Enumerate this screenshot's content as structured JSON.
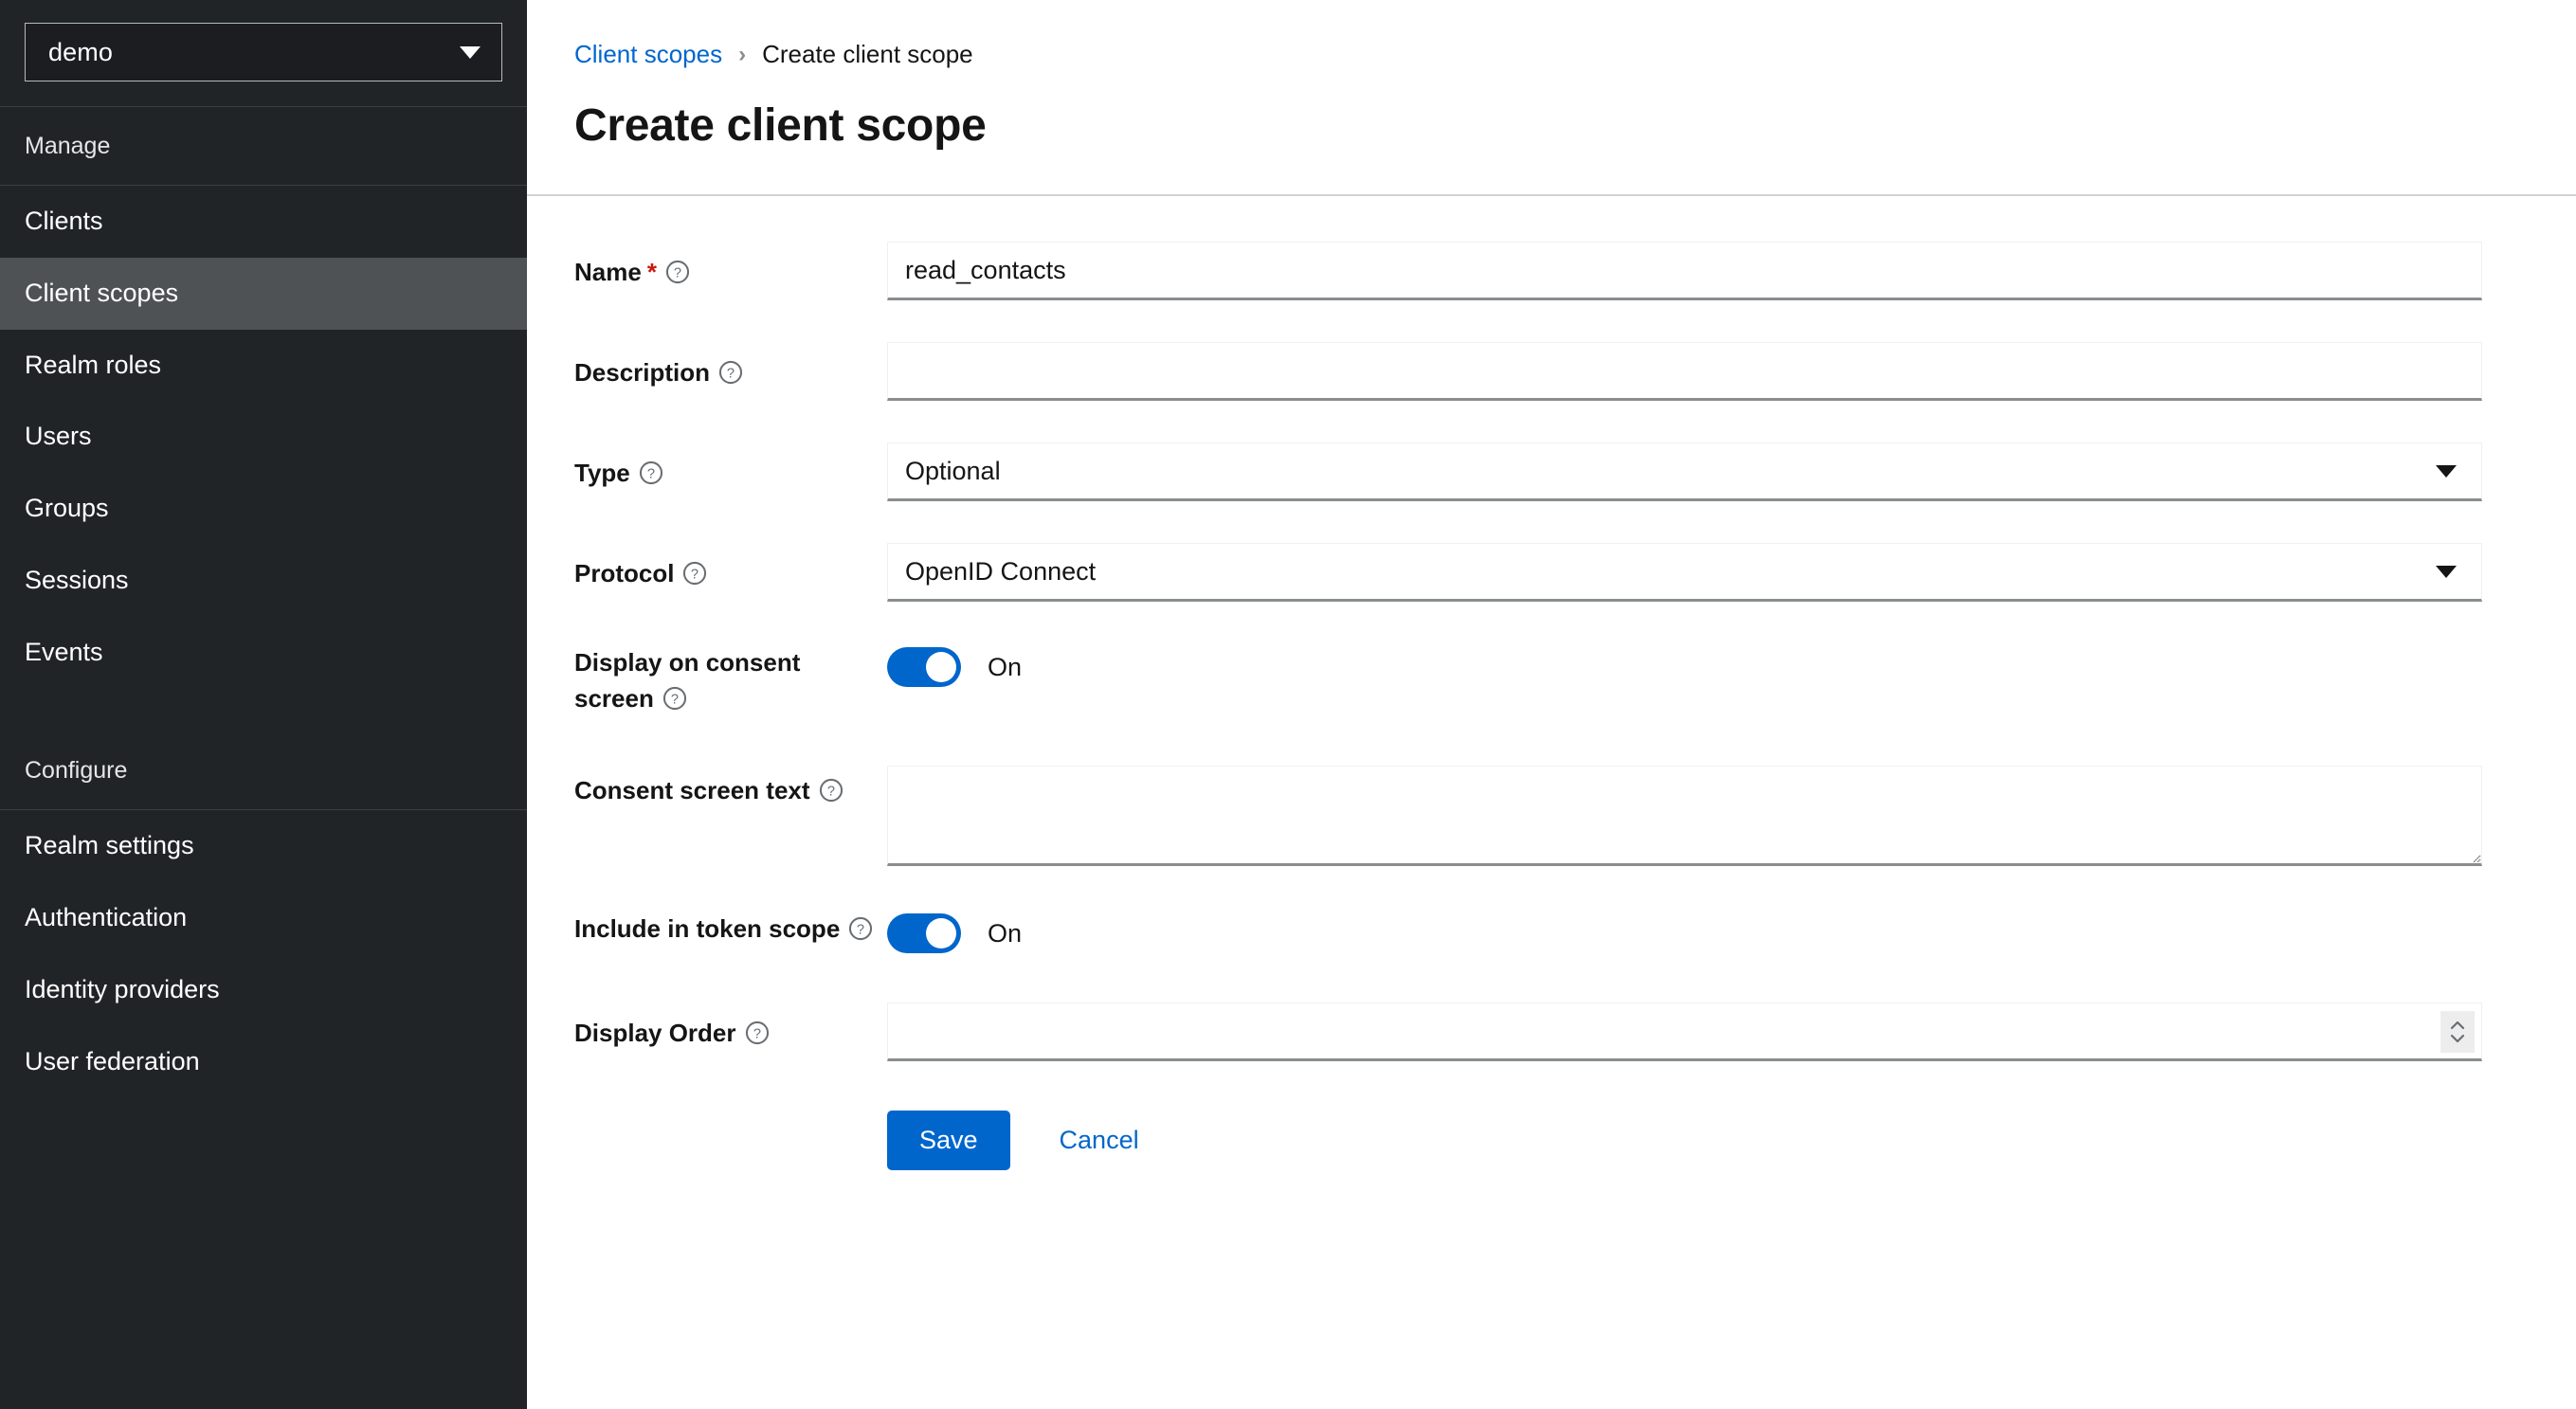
{
  "sidebar": {
    "realm_selector": {
      "value": "demo",
      "icon": "chevron-down-icon"
    },
    "sections": [
      {
        "title": "Manage",
        "items": [
          {
            "label": "Clients",
            "active": false
          },
          {
            "label": "Client scopes",
            "active": true
          },
          {
            "label": "Realm roles",
            "active": false
          },
          {
            "label": "Users",
            "active": false
          },
          {
            "label": "Groups",
            "active": false
          },
          {
            "label": "Sessions",
            "active": false
          },
          {
            "label": "Events",
            "active": false
          }
        ]
      },
      {
        "title": "Configure",
        "items": [
          {
            "label": "Realm settings",
            "active": false
          },
          {
            "label": "Authentication",
            "active": false
          },
          {
            "label": "Identity providers",
            "active": false
          },
          {
            "label": "User federation",
            "active": false
          }
        ]
      }
    ]
  },
  "header": {
    "breadcrumb": {
      "parent": "Client scopes",
      "separator": "›",
      "current": "Create client scope"
    },
    "title": "Create client scope"
  },
  "form": {
    "name": {
      "label": "Name",
      "required_marker": "*",
      "value": "read_contacts",
      "placeholder": "",
      "help_icon": "question-circle-icon"
    },
    "description": {
      "label": "Description",
      "value": "",
      "placeholder": "",
      "help_icon": "question-circle-icon"
    },
    "type": {
      "label": "Type",
      "value": "Optional",
      "help_icon": "question-circle-icon",
      "caret_icon": "caret-down-icon"
    },
    "protocol": {
      "label": "Protocol",
      "value": "OpenID Connect",
      "help_icon": "question-circle-icon",
      "caret_icon": "caret-down-icon"
    },
    "display_on_consent_screen": {
      "label": "Display on consent screen",
      "state": "On",
      "help_icon": "question-circle-icon"
    },
    "consent_screen_text": {
      "label": "Consent screen text",
      "value": "",
      "placeholder": "",
      "help_icon": "question-circle-icon"
    },
    "include_in_token_scope": {
      "label": "Include in token scope",
      "state": "On",
      "help_icon": "question-circle-icon"
    },
    "display_order": {
      "label": "Display Order",
      "value": "",
      "placeholder": "",
      "help_icon": "question-circle-icon",
      "stepper_icon": "stepper-up-down-icon"
    }
  },
  "actions": {
    "save_label": "Save",
    "cancel_label": "Cancel"
  },
  "colors": {
    "accent_blue": "#0066cc",
    "sidebar_bg": "#212427",
    "sidebar_active": "#4f5255",
    "required_red": "#c9190b",
    "text_dark": "#151515"
  }
}
